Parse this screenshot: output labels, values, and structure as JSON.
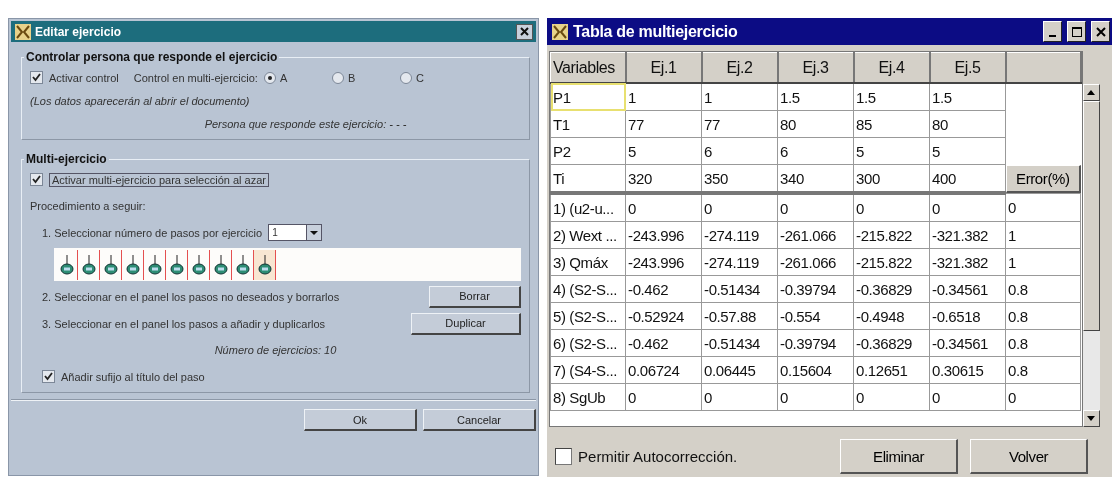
{
  "edit_dialog": {
    "title": "Editar ejercicio",
    "control_group": {
      "legend": "Controlar persona que responde el ejercicio",
      "activate": {
        "label": "Activar control",
        "checked": true
      },
      "radio_label": "Control en multi-ejercicio:",
      "options": [
        {
          "label": "A",
          "selected": true
        },
        {
          "label": "B",
          "selected": false
        },
        {
          "label": "C",
          "selected": false
        }
      ],
      "note": "(Los datos aparecerán al abrir el documento)",
      "person": "Persona que responde este ejercicio: - - -"
    },
    "multi_group": {
      "legend": "Multi-ejercicio",
      "activate": {
        "label": "Activar multi-ejercicio para selección al azar",
        "checked": true
      },
      "procedure": "Procedimiento a seguir:",
      "step1": "1. Seleccionar número de pasos por ejercicio",
      "steps_value": "1",
      "steps": [
        {
          "selected": false
        },
        {
          "selected": false
        },
        {
          "selected": false
        },
        {
          "selected": false
        },
        {
          "selected": false
        },
        {
          "selected": false
        },
        {
          "selected": false
        },
        {
          "selected": false
        },
        {
          "selected": false
        },
        {
          "selected": true
        }
      ],
      "step2": "2. Seleccionar en el panel los pasos no deseados y borrarlos",
      "delete_button": "Borrar",
      "step3": "3. Seleccionar en el panel los pasos a añadir y duplicarlos",
      "duplicate_button": "Duplicar",
      "count": "Número de ejercicios: 10",
      "suffix": {
        "label": "Añadir sufijo al título del paso",
        "checked": true
      }
    },
    "buttons": [
      "Ok",
      "Cancelar"
    ]
  },
  "table_window": {
    "title": "Tabla de multiejercicio",
    "columns": [
      "Variables",
      "Ej.1",
      "Ej.2",
      "Ej.3",
      "Ej.4",
      "Ej.5"
    ],
    "input_rows": [
      {
        "label": "P1",
        "focused": true,
        "values": [
          "1",
          "1",
          "1.5",
          "1.5",
          "1.5"
        ]
      },
      {
        "label": "T1",
        "focused": false,
        "values": [
          "77",
          "77",
          "80",
          "85",
          "80"
        ]
      },
      {
        "label": "P2",
        "focused": false,
        "values": [
          "5",
          "6",
          "6",
          "5",
          "5"
        ]
      },
      {
        "label": "Ti",
        "focused": false,
        "values": [
          "320",
          "350",
          "340",
          "300",
          "400"
        ]
      }
    ],
    "error_button": "Error(%)",
    "result_rows": [
      {
        "label": "1) (u2-u...",
        "values": [
          "0",
          "0",
          "0",
          "0",
          "0"
        ],
        "error": "0"
      },
      {
        "label": "2) Wext ...",
        "values": [
          "-243.996",
          "-274.119",
          "-261.066",
          "-215.822",
          "-321.382"
        ],
        "error": "1"
      },
      {
        "label": "3) Qmáx",
        "values": [
          "-243.996",
          "-274.119",
          "-261.066",
          "-215.822",
          "-321.382"
        ],
        "error": "1"
      },
      {
        "label": "4) (S2-S...",
        "values": [
          "-0.462",
          "-0.51434",
          "-0.39794",
          "-0.36829",
          "-0.34561"
        ],
        "error": "0.8"
      },
      {
        "label": "5) (S2-S...",
        "values": [
          "-0.52924",
          "-0.57.88",
          "-0.554",
          "-0.4948",
          "-0.6518"
        ],
        "error": "0.8"
      },
      {
        "label": "6) (S2-S...",
        "values": [
          "-0.462",
          "-0.51434",
          "-0.39794",
          "-0.36829",
          "-0.34561"
        ],
        "error": "0.8"
      },
      {
        "label": "7) (S4-S...",
        "values": [
          "0.06724",
          "0.06445",
          "0.15604",
          "0.12651",
          "0.30615"
        ],
        "error": "0.8"
      },
      {
        "label": "8) SgUb",
        "values": [
          "0",
          "0",
          "0",
          "0",
          "0"
        ],
        "error": "0"
      }
    ],
    "autocorrect": {
      "label": "Permitir Autocorrección.",
      "checked": false
    },
    "buttons": [
      "Eliminar",
      "Volver"
    ]
  }
}
